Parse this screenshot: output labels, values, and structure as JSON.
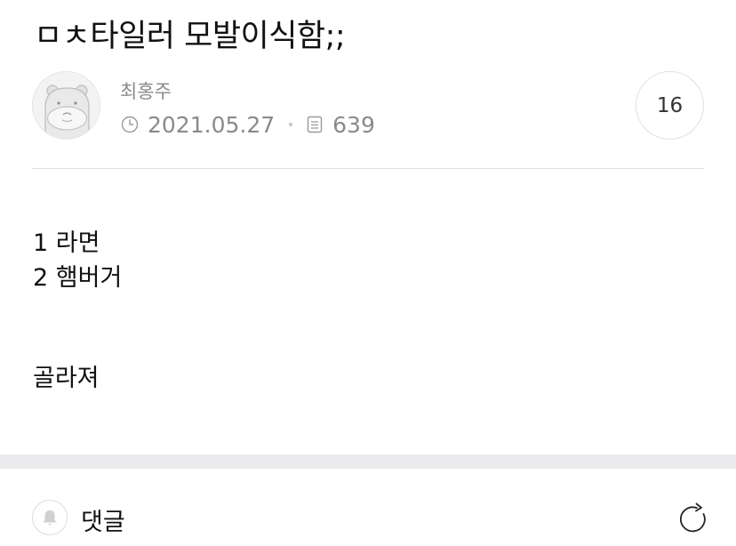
{
  "post": {
    "title": "ㅁㅊ타일러 모발이식함;;",
    "author": "최홍주",
    "date": "2021.05.27",
    "views": "639",
    "comment_count": "16",
    "body_lines": [
      "1 라면",
      "2 햄버거",
      "골라져"
    ]
  },
  "comments": {
    "label": "댓글"
  },
  "icons": {
    "avatar": "hippo-avatar-icon",
    "date": "clock-icon",
    "views": "document-icon",
    "comments": "bell-icon",
    "refresh": "refresh-icon"
  },
  "colors": {
    "meta_text": "#8a8a8a",
    "section_bar": "#ebebed",
    "divider": "#e2e2e2"
  }
}
